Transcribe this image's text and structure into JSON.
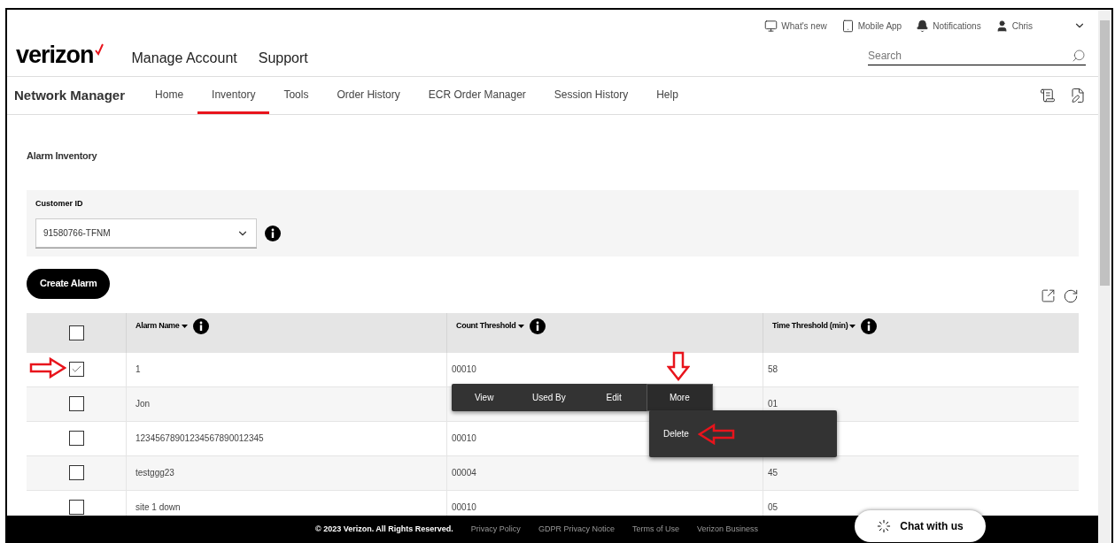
{
  "header": {
    "utility_links": [
      {
        "kind": "monitor",
        "label": "What's new"
      },
      {
        "kind": "tablet",
        "label": "Mobile App"
      },
      {
        "kind": "bell",
        "label": "Notifications"
      },
      {
        "kind": "user",
        "label": "Chris"
      }
    ],
    "logo": "verizon",
    "top_nav": [
      "Manage Account",
      "Support"
    ],
    "search": {
      "placeholder": "Search"
    }
  },
  "app_nav": {
    "title": "Network Manager",
    "tabs": [
      {
        "label": "Home",
        "selected": false
      },
      {
        "label": "Inventory",
        "selected": true
      },
      {
        "label": "Tools",
        "selected": false
      },
      {
        "label": "Order History",
        "selected": false
      },
      {
        "label": "ECR Order Manager",
        "selected": false
      },
      {
        "label": "Session History",
        "selected": false
      },
      {
        "label": "Help",
        "selected": false
      }
    ]
  },
  "page": {
    "title": "Alarm Inventory",
    "customer_id": {
      "label": "Customer ID",
      "value": "91580766-TFNM"
    },
    "create_button": "Create Alarm"
  },
  "table": {
    "select_all_checked": false,
    "columns": [
      "Alarm Name",
      "Count Threshold",
      "Time Threshold (min)"
    ],
    "rows": [
      {
        "checked": true,
        "alarm_name": "1",
        "count_threshold": "00010",
        "time_threshold": "58"
      },
      {
        "checked": false,
        "alarm_name": "Jon",
        "time_threshold": "01"
      },
      {
        "checked": false,
        "alarm_name": "12345678901234567890012345",
        "count_threshold": "00010"
      },
      {
        "checked": false,
        "alarm_name": "testggg23",
        "count_threshold": "00004",
        "time_threshold": "45"
      },
      {
        "checked": false,
        "alarm_name": "site 1 down",
        "count_threshold": "00010",
        "time_threshold": "05"
      }
    ]
  },
  "action_bar": {
    "items": [
      {
        "label": "View",
        "selected": false
      },
      {
        "label": "Used By",
        "selected": false
      },
      {
        "label": "Edit",
        "selected": false
      },
      {
        "label": "More",
        "selected": true
      }
    ]
  },
  "submenu": {
    "items": [
      "Delete"
    ]
  },
  "footer": {
    "copyright": "© 2023 Verizon. All Rights Reserved.",
    "links": [
      "Privacy Policy",
      "GDPR Privacy Notice",
      "Terms of Use",
      "Verizon Business"
    ]
  },
  "chat_button": "Chat with us"
}
